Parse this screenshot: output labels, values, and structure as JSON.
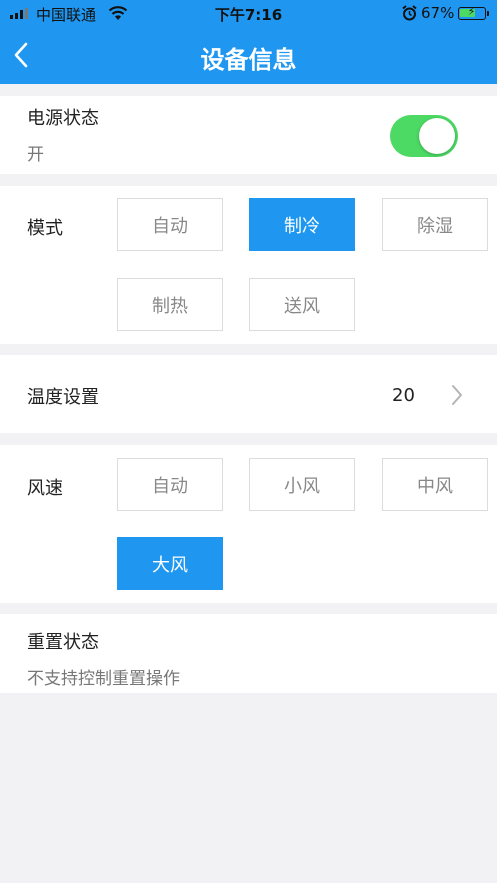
{
  "status_bar": {
    "carrier": "中国联通",
    "time": "下午7:16",
    "battery_pct": "67%",
    "battery_level": 0.67,
    "icons": [
      "signal-icon",
      "wifi-icon",
      "alarm-icon",
      "battery-icon"
    ]
  },
  "nav": {
    "title": "设备信息",
    "back_icon": "chevron-left-icon"
  },
  "power": {
    "label": "电源状态",
    "value": "开",
    "toggle_on": true
  },
  "mode": {
    "label": "模式",
    "options": [
      "自动",
      "制冷",
      "除湿",
      "制热",
      "送风"
    ],
    "selected": "制冷"
  },
  "temperature": {
    "label": "温度设置",
    "value": "20",
    "icon": "chevron-right-icon"
  },
  "fan": {
    "label": "风速",
    "options": [
      "自动",
      "小风",
      "中风",
      "大风"
    ],
    "selected": "大风"
  },
  "reset": {
    "label": "重置状态",
    "note": "不支持控制重置操作"
  },
  "colors": {
    "accent": "#1f97f0",
    "toggle_on": "#4cd964",
    "background": "#f2f2f5"
  }
}
